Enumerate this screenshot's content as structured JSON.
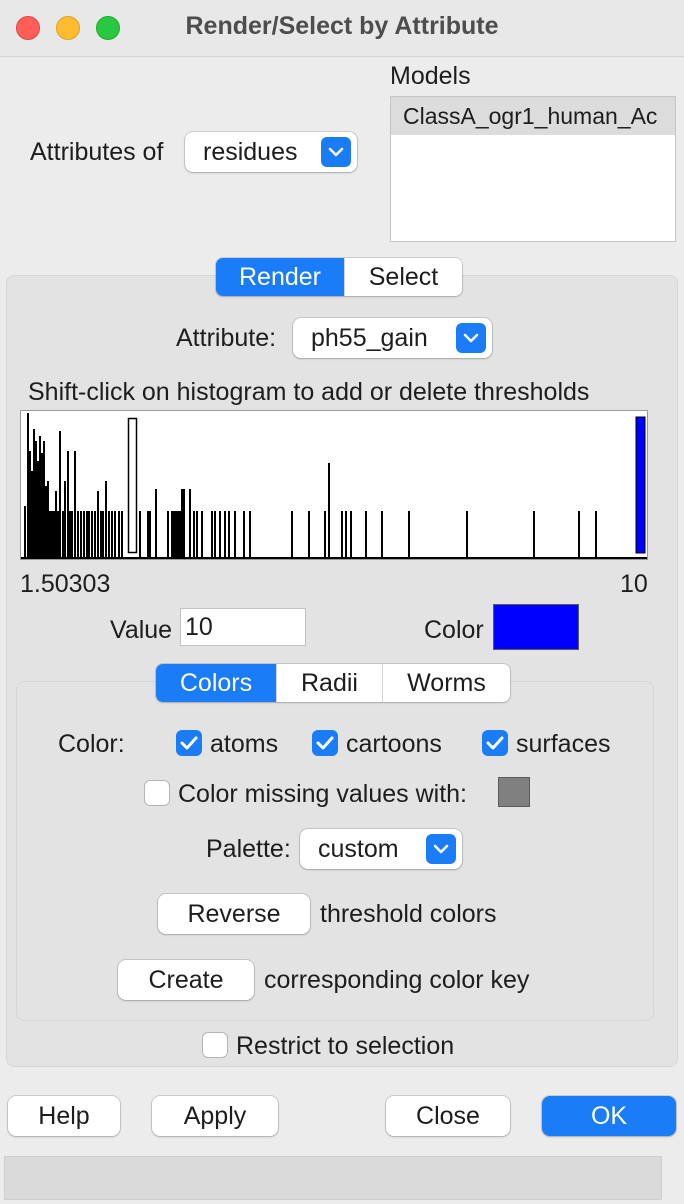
{
  "window": {
    "title": "Render/Select by Attribute"
  },
  "attributes_of": {
    "label": "Attributes of",
    "value": "residues"
  },
  "models": {
    "label": "Models",
    "items": [
      "ClassA_ogr1_human_Ac"
    ]
  },
  "main_tabs": {
    "render": "Render",
    "select": "Select",
    "active": "Render"
  },
  "attribute": {
    "label": "Attribute:",
    "value": "ph55_gain"
  },
  "histogram": {
    "instruction": "Shift-click on histogram to add or delete thresholds",
    "min_label": "1.50303",
    "max_label": "10"
  },
  "value_field": {
    "label": "Value",
    "value": "10"
  },
  "color_field": {
    "label": "Color",
    "color": "#0000ff"
  },
  "sub_tabs": {
    "colors": "Colors",
    "radii": "Radii",
    "worms": "Worms",
    "active": "Colors"
  },
  "color_targets": {
    "label": "Color:",
    "atoms": {
      "label": "atoms",
      "checked": true
    },
    "cartoons": {
      "label": "cartoons",
      "checked": true
    },
    "surfaces": {
      "label": "surfaces",
      "checked": true
    }
  },
  "missing_values": {
    "label": "Color missing values with:",
    "checked": false,
    "color": "#808080"
  },
  "palette": {
    "label": "Palette:",
    "value": "custom"
  },
  "reverse": {
    "button": "Reverse",
    "text": "threshold colors"
  },
  "create_key": {
    "button": "Create",
    "text": "corresponding color key"
  },
  "restrict": {
    "label": "Restrict to selection",
    "checked": false
  },
  "buttons": {
    "help": "Help",
    "apply": "Apply",
    "close": "Close",
    "ok": "OK"
  },
  "colors": {
    "accent": "#1a7cf7"
  }
}
